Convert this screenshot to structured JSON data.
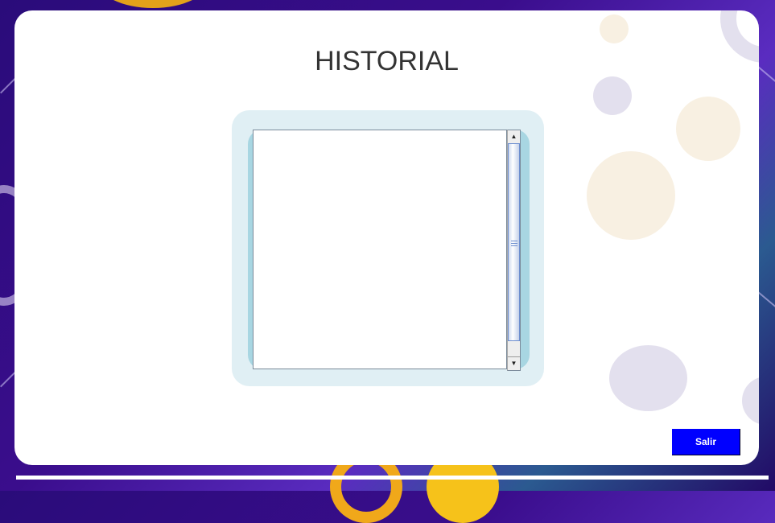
{
  "page": {
    "title": "HISTORIAL"
  },
  "history": {
    "text": ""
  },
  "actions": {
    "exit_label": "Salir"
  },
  "colors": {
    "exit_button": "#0000ff",
    "frame": "#e0eff4"
  }
}
